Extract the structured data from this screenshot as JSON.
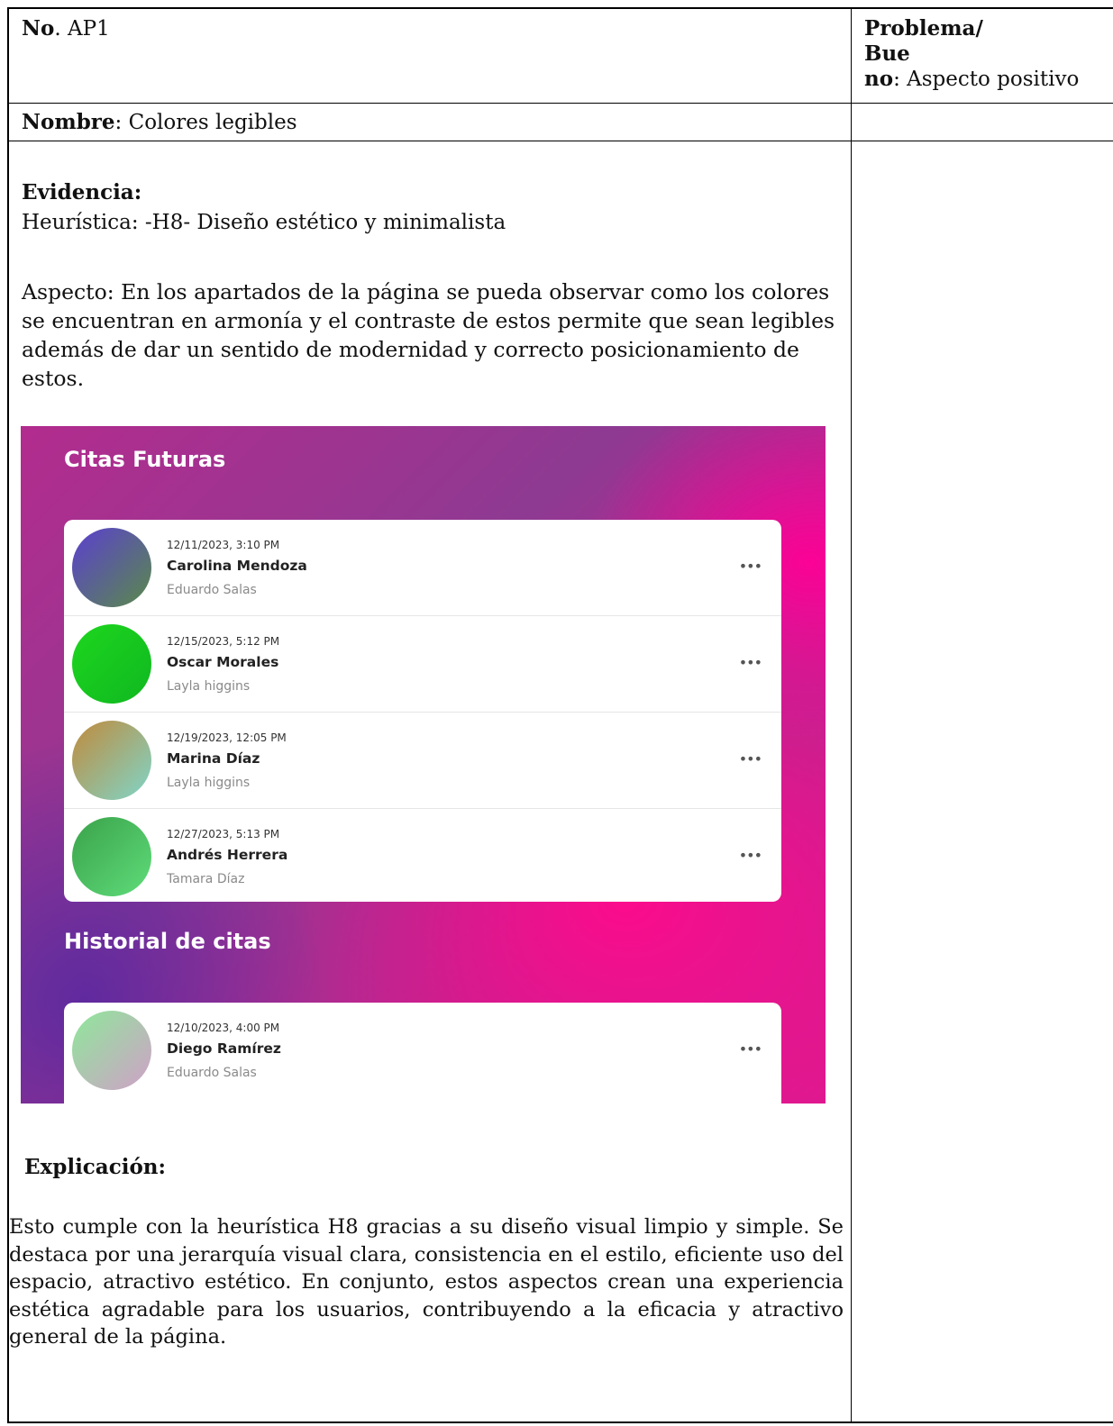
{
  "header": {
    "no_label": "No",
    "no_value": ". AP1",
    "problema_line1": "Problema/",
    "problema_line2": "Bue",
    "problema_line3_label": "no",
    "problema_line3_value": ": Aspecto positivo"
  },
  "nombre": {
    "label": "Nombre",
    "value": ": Colores legibles"
  },
  "evidencia": {
    "title": "Evidencia:",
    "heuristica": "Heurística: -H8- Diseño estético y minimalista",
    "aspecto": "Aspecto: En los apartados de la página se pueda observar como los colores se encuentran en armonía y el contraste de estos permite que sean legibles además de dar un sentido de modernidad y correcto posicionamiento de estos."
  },
  "screenshot": {
    "section1_title": "Citas Futuras",
    "section2_title": "Historial de citas",
    "future": [
      {
        "datetime": "12/11/2023, 3:10 PM",
        "name": "Carolina Mendoza",
        "provider": "Eduardo Salas",
        "avatar_color": "linear-gradient(135deg,#5b3fd0,#5a8a4a)"
      },
      {
        "datetime": "12/15/2023, 5:12 PM",
        "name": "Oscar Morales",
        "provider": "Layla higgins",
        "avatar_color": "linear-gradient(135deg,#1ed61e,#0fb820)"
      },
      {
        "datetime": "12/19/2023, 12:05 PM",
        "name": "Marina Díaz",
        "provider": "Layla higgins",
        "avatar_color": "linear-gradient(135deg,#c08a3c,#7fd6c9)"
      },
      {
        "datetime": "12/27/2023, 5:13 PM",
        "name": " Andrés Herrera",
        "provider": "Tamara Díaz",
        "avatar_color": "linear-gradient(135deg,#3aa24a,#5fdc7a)"
      }
    ],
    "history": [
      {
        "datetime": "12/10/2023, 4:00 PM",
        "name": "Diego Ramírez",
        "provider": "Eduardo Salas",
        "avatar_color": "linear-gradient(135deg,#8ee89a,#d0a0c8)"
      }
    ],
    "more_icon": "more-horizontal-icon",
    "more_label": "•••"
  },
  "explicacion": {
    "title": "Explicación:",
    "text": "Esto cumple con la heurística H8 gracias a su diseño visual limpio y simple. Se destaca por una jerarquía visual clara, consistencia en el estilo, eficiente uso del espacio, atractivo estético. En conjunto, estos aspectos crean una experiencia estética agradable para los usuarios, contribuyendo a la eficacia y atractivo general de la página."
  }
}
